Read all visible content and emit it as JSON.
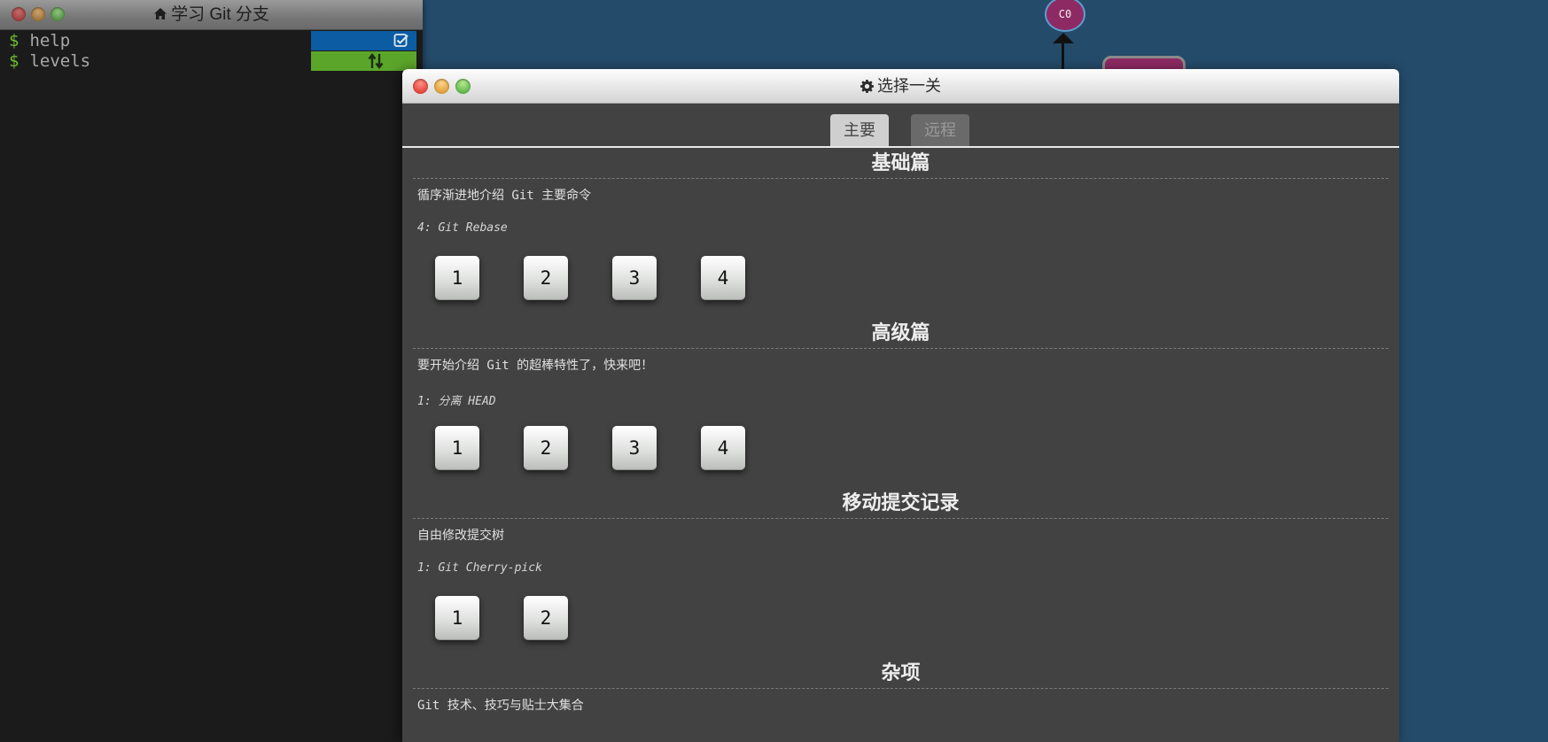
{
  "terminal": {
    "title": "学习 Git 分支",
    "lines": [
      {
        "prompt": "$",
        "command": "help"
      },
      {
        "prompt": "$",
        "command": "levels"
      }
    ],
    "strip_colors": {
      "help": "#0b5ca3",
      "levels": "#5ba62a"
    }
  },
  "visualization": {
    "node_label": "C0",
    "node_color": "#8e2a63"
  },
  "modal": {
    "title": "选择一关",
    "tabs": [
      {
        "label": "主要",
        "active": true
      },
      {
        "label": "远程",
        "active": false
      }
    ],
    "sections": [
      {
        "heading": "基础篇",
        "description": "循序渐进地介绍 Git 主要命令",
        "current_level": "4: Git Rebase",
        "levels": [
          "1",
          "2",
          "3",
          "4"
        ]
      },
      {
        "heading": "高级篇",
        "description": "要开始介绍 Git 的超棒特性了，快来吧！",
        "current_level": "1: 分离 HEAD",
        "levels": [
          "1",
          "2",
          "3",
          "4"
        ]
      },
      {
        "heading": "移动提交记录",
        "description": "自由修改提交树",
        "current_level": "1: Git Cherry-pick",
        "levels": [
          "1",
          "2"
        ]
      },
      {
        "heading": "杂项",
        "description": "Git 技术、技巧与贴士大集合",
        "current_level": "",
        "levels": []
      }
    ]
  },
  "icons": {
    "home": "home-icon",
    "gear": "gear-icon",
    "check": "checkbox-icon",
    "swap": "sort-arrows-icon"
  }
}
